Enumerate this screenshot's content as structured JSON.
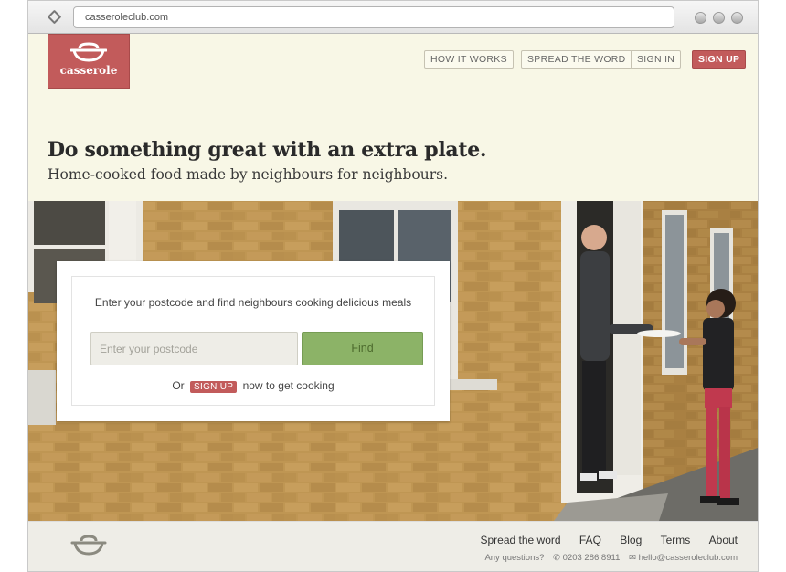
{
  "browser": {
    "url": "casseroleclub.com"
  },
  "logo": {
    "text": "casserole"
  },
  "nav": {
    "how_it_works": "HOW IT WORKS",
    "spread_the_word": "SPREAD THE WORD",
    "sign_in": "SIGN IN",
    "sign_up": "SIGN UP"
  },
  "hero": {
    "headline": "Do something great with an extra plate.",
    "subline": "Home-cooked food made by neighbours for neighbours."
  },
  "search": {
    "prompt": "Enter your postcode and find neighbours cooking delicious meals",
    "placeholder": "Enter your postcode",
    "value": "",
    "find_label": "Find",
    "or_text": "Or",
    "signup_label": "SIGN UP",
    "after_text": "now to get cooking"
  },
  "footer": {
    "links": [
      "Spread the word",
      "FAQ",
      "Blog",
      "Terms",
      "About"
    ],
    "questions": "Any questions?",
    "phone": "0203 286 8911",
    "email": "hello@casseroleclub.com"
  },
  "colors": {
    "brand_red": "#c25b5b",
    "find_green": "#8cb367",
    "header_bg": "#f8f7e6"
  }
}
